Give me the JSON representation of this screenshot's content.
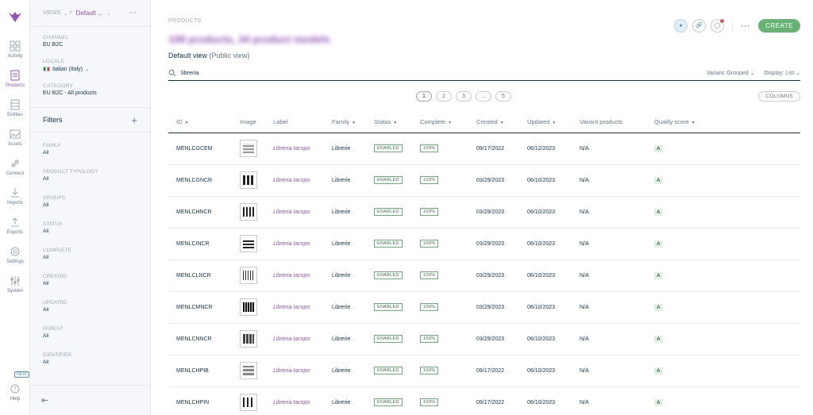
{
  "nav": {
    "items": [
      {
        "label": "Activity",
        "icon": "dashboard-icon"
      },
      {
        "label": "Products",
        "icon": "products-icon"
      },
      {
        "label": "Entities",
        "icon": "entities-icon"
      },
      {
        "label": "Assets",
        "icon": "assets-icon"
      },
      {
        "label": "Connect",
        "icon": "connect-icon"
      },
      {
        "label": "Imports",
        "icon": "imports-icon"
      },
      {
        "label": "Exports",
        "icon": "exports-icon"
      },
      {
        "label": "Settings",
        "icon": "settings-icon"
      },
      {
        "label": "System",
        "icon": "system-icon"
      }
    ],
    "help_label": "Help",
    "new_badge": "NEW",
    "accent": "#9452ba"
  },
  "column": {
    "views_label": "VIEWS",
    "view_name": "Default ...",
    "channel_label": "CHANNEL",
    "channel_value": "EU B2C",
    "locale_label": "LOCALE",
    "locale_value": "Italian (Italy)",
    "category_label": "CATEGORY",
    "category_value": "EU B2C - All products",
    "filters_title": "Filters",
    "filters": [
      {
        "label": "FAMILY",
        "value": "All"
      },
      {
        "label": "PRODUCT TYPOLOGY",
        "value": "All"
      },
      {
        "label": "GROUPS",
        "value": "All"
      },
      {
        "label": "STATUS",
        "value": "All"
      },
      {
        "label": "COMPLETE",
        "value": "All"
      },
      {
        "label": "CREATED",
        "value": "All"
      },
      {
        "label": "UPDATED",
        "value": "All"
      },
      {
        "label": "PARENT",
        "value": "All"
      },
      {
        "label": "IDENTIFIER",
        "value": "All"
      }
    ]
  },
  "header": {
    "breadcrumb": "PRODUCTS",
    "count_title": "108 products, 34 product models",
    "view_title": "Default view",
    "view_scope": "(Public view)",
    "create_label": "CREATE"
  },
  "search": {
    "query": "libreria",
    "variant_label": "Variant: Grouped",
    "display_label": "Display: List"
  },
  "pagination": {
    "pages": [
      "1",
      "2",
      "3",
      "...",
      "5"
    ],
    "current": "1",
    "columns_label": "COLUMNS"
  },
  "table": {
    "headers": [
      "ID",
      "Image",
      "Label",
      "Family",
      "Status",
      "Complete",
      "Created",
      "Updated",
      "Variant products",
      "Quality score"
    ],
    "rows": [
      {
        "id": "MENLCGCEM",
        "label": "Libreria Iacopo",
        "family": "Librerie",
        "status": "ENABLED",
        "complete": "100%",
        "created": "09/17/2022",
        "updated": "06/12/2023",
        "variants": "N/A",
        "quality": "A"
      },
      {
        "id": "MENLCGNCR",
        "label": "Libreria Iacopo",
        "family": "Librerie",
        "status": "ENABLED",
        "complete": "100%",
        "created": "03/29/2023",
        "updated": "06/10/2023",
        "variants": "N/A",
        "quality": "A"
      },
      {
        "id": "MENLCHNCR",
        "label": "Libreria Iacopo",
        "family": "Librerie",
        "status": "ENABLED",
        "complete": "100%",
        "created": "03/29/2023",
        "updated": "06/10/2023",
        "variants": "N/A",
        "quality": "A"
      },
      {
        "id": "MENLCINCR",
        "label": "Libreria Iacopo",
        "family": "Librerie",
        "status": "ENABLED",
        "complete": "100%",
        "created": "03/29/2023",
        "updated": "06/10/2023",
        "variants": "N/A",
        "quality": "A"
      },
      {
        "id": "MENLCLNCR",
        "label": "Libreria Iacopo",
        "family": "Librerie",
        "status": "ENABLED",
        "complete": "100%",
        "created": "03/29/2023",
        "updated": "06/10/2023",
        "variants": "N/A",
        "quality": "A"
      },
      {
        "id": "MENLCMNCR",
        "label": "Libreria Iacopo",
        "family": "Librerie",
        "status": "ENABLED",
        "complete": "100%",
        "created": "03/29/2023",
        "updated": "06/10/2023",
        "variants": "N/A",
        "quality": "A"
      },
      {
        "id": "MENLCNNCR",
        "label": "Libreria Iacopo",
        "family": "Librerie",
        "status": "ENABLED",
        "complete": "100%",
        "created": "03/29/2023",
        "updated": "06/10/2023",
        "variants": "N/A",
        "quality": "A"
      },
      {
        "id": "MENLCHPIB",
        "label": "Libreria Iacopo",
        "family": "Librerie",
        "status": "ENABLED",
        "complete": "100%",
        "created": "09/17/2022",
        "updated": "06/10/2023",
        "variants": "N/A",
        "quality": "A"
      },
      {
        "id": "MENLCHPIN",
        "label": "Libreria Iacopo",
        "family": "Librerie",
        "status": "ENABLED",
        "complete": "100%",
        "created": "09/17/2022",
        "updated": "06/10/2023",
        "variants": "N/A",
        "quality": "A"
      }
    ]
  }
}
